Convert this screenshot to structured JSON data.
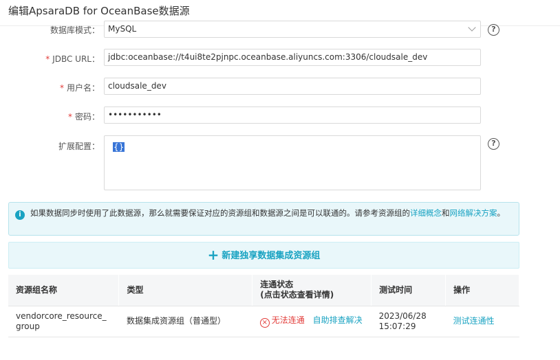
{
  "dialog": {
    "title": "编辑ApsaraDB for OceanBase数据源"
  },
  "form": {
    "db_mode": {
      "label": "数据库模式：",
      "value": "MySQL"
    },
    "jdbc_url": {
      "label": "JDBC URL：",
      "value": "jdbc:oceanbase://t4ui8te2pjnpc.oceanbase.aliyuncs.com:3306/cloudsale_dev"
    },
    "username": {
      "label": "用户名：",
      "value": "cloudsale_dev"
    },
    "password": {
      "label": "密码：",
      "value": "•••••••••••"
    },
    "ext_config": {
      "label": "扩展配置：",
      "value": "{}"
    },
    "required_mark": "*",
    "help_symbol": "?"
  },
  "notice": {
    "text_before": "如果数据同步时使用了此数据源，那么就需要保证对应的资源组和数据源之间是可以联通的。请参考资源组的",
    "link1": "详细概念",
    "and": "和",
    "link2": "网络解决方案",
    "end": "。"
  },
  "new_resource_group_button": "新建独享数据集成资源组",
  "table": {
    "headers": [
      "资源组名称",
      "类型",
      "连通状态\n(点击状态查看详情)",
      "测试时间",
      "操作"
    ],
    "rows": [
      {
        "name": "vendorcore_resource_group",
        "type": "数据集成资源组（普通型）",
        "status": "无法连通",
        "status_link": "自助排查解决",
        "test_time": "2023/06/28 15:07:29",
        "action": "测试连通性"
      }
    ]
  },
  "colors": {
    "accent": "#1aa3c2",
    "error": "#e23c39",
    "required": "#e23c39"
  }
}
